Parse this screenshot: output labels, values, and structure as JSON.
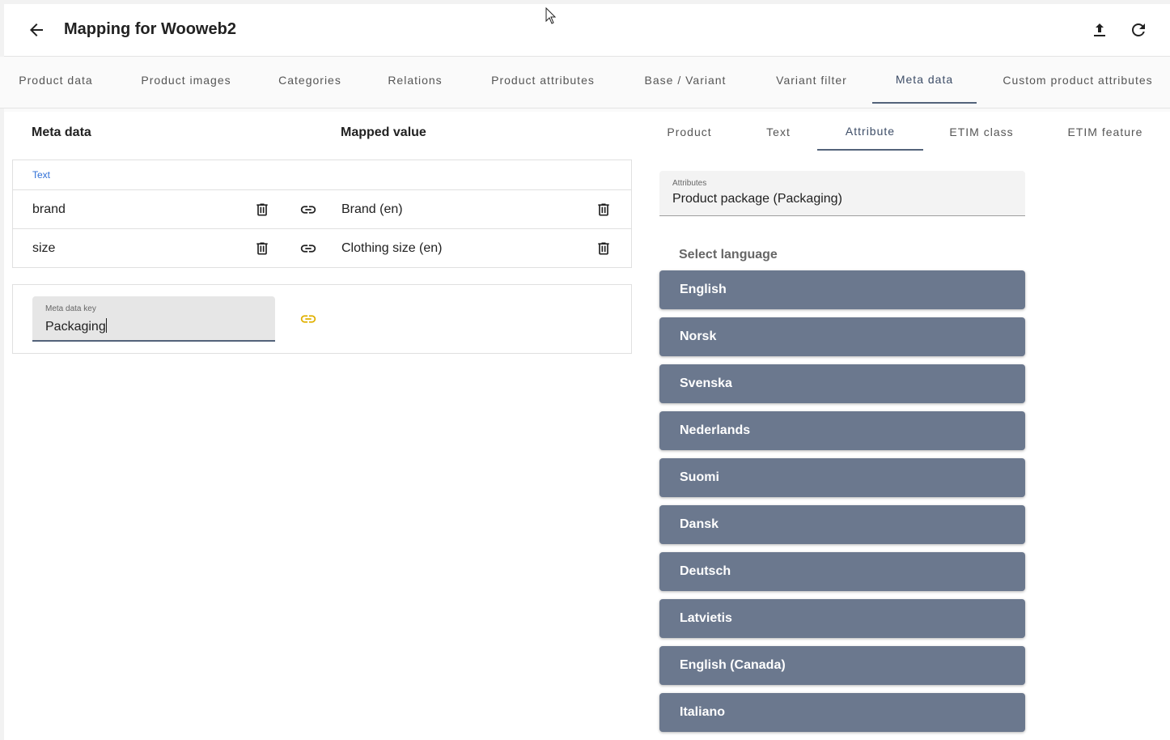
{
  "header": {
    "title": "Mapping for Wooweb2",
    "back_icon": "arrow-left-icon",
    "upload_icon": "upload-icon",
    "refresh_icon": "refresh-icon"
  },
  "tabs": [
    {
      "label": "Product data",
      "active": false
    },
    {
      "label": "Product images",
      "active": false
    },
    {
      "label": "Categories",
      "active": false
    },
    {
      "label": "Relations",
      "active": false
    },
    {
      "label": "Product attributes",
      "active": false
    },
    {
      "label": "Base / Variant",
      "active": false
    },
    {
      "label": "Variant filter",
      "active": false
    },
    {
      "label": "Meta data",
      "active": true
    },
    {
      "label": "Custom product attributes",
      "active": false
    }
  ],
  "mapping": {
    "col_meta": "Meta data",
    "col_mapped": "Mapped value",
    "section_label": "Text",
    "rows": [
      {
        "key": "brand",
        "value": "Brand (en)"
      },
      {
        "key": "size",
        "value": "Clothing size (en)"
      }
    ],
    "new_key": {
      "label": "Meta data key",
      "value": "Packaging"
    }
  },
  "source_tabs": [
    {
      "label": "Product",
      "active": false
    },
    {
      "label": "Text",
      "active": false
    },
    {
      "label": "Attribute",
      "active": true
    },
    {
      "label": "ETIM class",
      "active": false
    },
    {
      "label": "ETIM feature",
      "active": false
    }
  ],
  "attribute_field": {
    "label": "Attributes",
    "value": "Product package (Packaging)"
  },
  "languages": {
    "title": "Select language",
    "items": [
      "English",
      "Norsk",
      "Svenska",
      "Nederlands",
      "Suomi",
      "Dansk",
      "Deutsch",
      "Latvietis",
      "English (Canada)",
      "Italiano"
    ]
  },
  "colors": {
    "accent": "#53637a",
    "language_button": "#6b788e",
    "link_highlight": "#e0b000",
    "section_label": "#2f6fd6"
  }
}
